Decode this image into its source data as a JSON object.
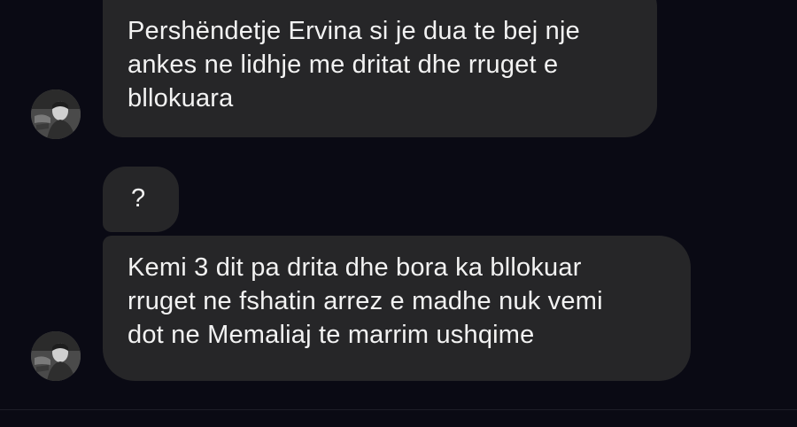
{
  "messages": [
    {
      "text": "Pershëndetje Ervina si je dua te bej nje\nankes ne lidhje me dritat dhe rruget e\nbllokuara"
    },
    {
      "text": "?"
    },
    {
      "text": "Kemi 3 dit pa drita dhe bora ka bllokuar\nrruget ne fshatin arrez e madhe nuk vemi\ndot ne Memaliaj te marrim ushqime"
    }
  ],
  "colors": {
    "background": "#0a0a14",
    "bubble": "#262628",
    "text": "#f2f2f2"
  },
  "icons": {
    "avatar": "user-photo-avatar"
  }
}
